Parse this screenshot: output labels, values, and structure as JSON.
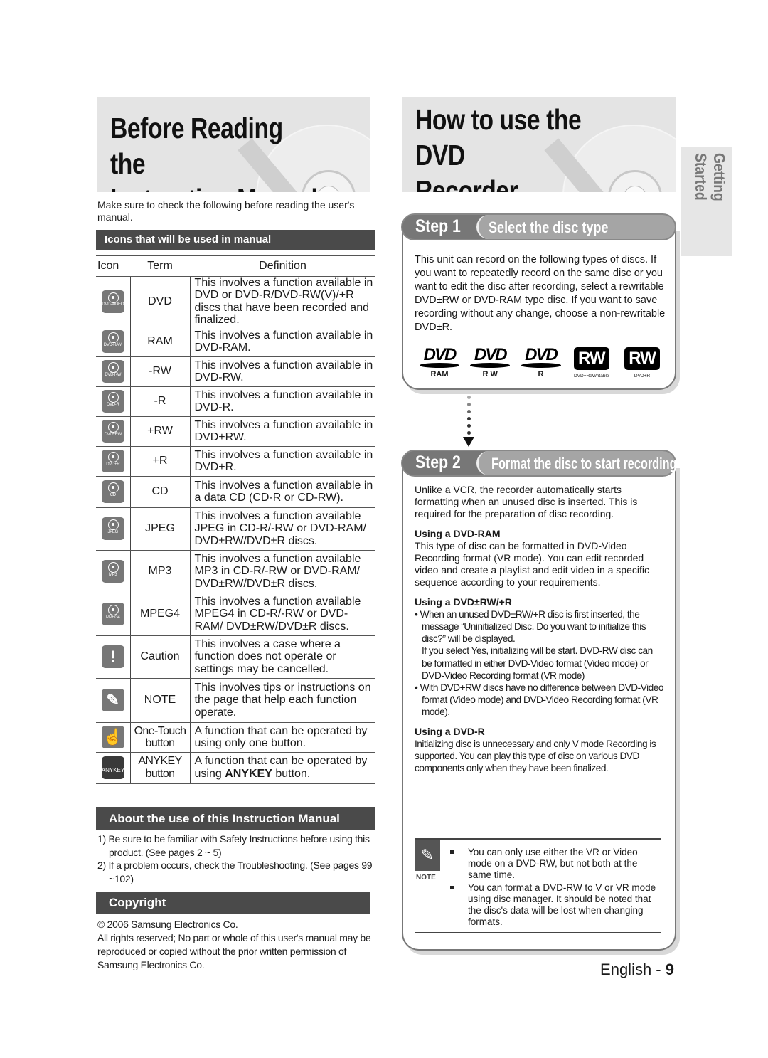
{
  "left": {
    "title": [
      "Before Reading the",
      "Instruction Manual"
    ],
    "intro": "Make sure to check the following before reading the user's manual.",
    "icons_section_title": "Icons that will be used in manual",
    "table": {
      "headers": [
        "Icon",
        "Term",
        "Definition"
      ],
      "rows": [
        {
          "icon": "dvd-video-disc-icon",
          "icon_label": "DVD-VIDEO",
          "term": "DVD",
          "definition": "This involves a function available in DVD or DVD-R/DVD-RW(V)/+R discs that have been recorded and finalized."
        },
        {
          "icon": "dvd-ram-disc-icon",
          "icon_label": "DVD-RAM",
          "term": "RAM",
          "definition": "This involves a function available in DVD-RAM."
        },
        {
          "icon": "dvd-rw-disc-icon",
          "icon_label": "DVD-RW",
          "term": "-RW",
          "definition": "This involves a function available in DVD-RW."
        },
        {
          "icon": "dvd-r-disc-icon",
          "icon_label": "DVD-R",
          "term": "-R",
          "definition": "This involves a function available in DVD-R."
        },
        {
          "icon": "dvd-plus-rw-disc-icon",
          "icon_label": "DVD+RW",
          "term": "+RW",
          "definition": "This involves a function available in DVD+RW."
        },
        {
          "icon": "dvd-plus-r-disc-icon",
          "icon_label": "DVD+R",
          "term": "+R",
          "definition": "This involves a function available in DVD+R."
        },
        {
          "icon": "cd-disc-icon",
          "icon_label": "CD",
          "term": "CD",
          "definition": "This involves a function available in a data CD (CD-R or CD-RW)."
        },
        {
          "icon": "jpeg-disc-icon",
          "icon_label": "JPEG",
          "term": "JPEG",
          "definition": "This involves a function available JPEG in CD-R/-RW or DVD-RAM/ DVD±RW/DVD±R discs."
        },
        {
          "icon": "mp3-disc-icon",
          "icon_label": "MP3",
          "term": "MP3",
          "definition": "This involves a function available MP3 in CD-R/-RW or DVD-RAM/ DVD±RW/DVD±R discs."
        },
        {
          "icon": "mpeg4-disc-icon",
          "icon_label": "MPEG4",
          "term": "MPEG4",
          "definition": "This involves a function available MPEG4 in CD-R/-RW or DVD-RAM/ DVD±RW/DVD±R discs."
        },
        {
          "icon": "caution-icon",
          "icon_label": "!",
          "term": "Caution",
          "definition": "This involves a case where a function does not operate or settings may be cancelled."
        },
        {
          "icon": "note-pencil-icon",
          "icon_label": "✎",
          "term": "NOTE",
          "definition": "This involves tips or instructions on the page that help each function operate."
        },
        {
          "icon": "one-touch-hand-icon",
          "icon_label": "☝",
          "term": "One-Touch button",
          "definition": "A function that can be operated by using only one button."
        },
        {
          "icon": "anykey-icon",
          "icon_label": "ANYKEY",
          "term": "ANYKEY button",
          "definition_pre": "A function that can be operated by using ",
          "definition_bold": "ANYKEY",
          "definition_post": " button."
        }
      ]
    },
    "about_title": "About the use of this Instruction Manual",
    "about_items": [
      "1) Be sure to be familiar with Safety Instructions before using this product. (See pages 2 ~ 5)",
      "2) If a problem occurs, check the Troubleshooting. (See pages 99 ~102)"
    ],
    "copyright_title": "Copyright",
    "copyright_lines": [
      "© 2006 Samsung Electronics Co.",
      "All rights reserved; No part or whole of this user's manual may be reproduced or copied without the prior written permission of Samsung Electronics Co."
    ]
  },
  "right": {
    "title": [
      "How to use the DVD",
      "Recorder"
    ],
    "side_tab": "Getting Started",
    "step1": {
      "number": "Step 1",
      "title": "Select the disc type",
      "text": "This unit can record on the following types of discs. If you want to repeatedly record on the same disc or you want to edit the disc after recording, select a rewritable DVD±RW or DVD-RAM type disc. If you want to save recording without any change, choose a non-rewritable DVD±R.",
      "logos": [
        {
          "mark": "DVD",
          "caption": "RAM"
        },
        {
          "mark": "DVD",
          "caption": "R W"
        },
        {
          "mark": "DVD",
          "caption": "R"
        },
        {
          "mark": "RW",
          "caption": "DVD+ReWritable"
        },
        {
          "mark": "RW",
          "caption": "DVD+R"
        }
      ]
    },
    "step2": {
      "number": "Step 2",
      "title": "Format the disc to start recording",
      "intro": "Unlike a VCR, the recorder automatically starts formatting when an unused disc is inserted. This is required for the preparation of disc recording.",
      "ram_title": "Using a DVD-RAM",
      "ram_text": "This type of disc can be formatted in DVD-Video Recording format (VR mode). You can edit recorded video and create a playlist and edit video in a specific sequence according to your requirements.",
      "rw_title": "Using a DVD±RW/+R",
      "rw_bullet1": "• When an unused DVD±RW/+R disc is first inserted, the message “Uninitialized Disc. Do you want to initialize this disc?” will be displayed.",
      "rw_bullet1b": "If you select Yes, initializing will be start. DVD-RW disc can be formatted in either DVD-Video format (Video mode) or DVD-Video Recording format (VR mode)",
      "rw_bullet2": "• With DVD+RW discs have no difference between DVD-Video format (Video mode) and DVD-Video Recording format (VR mode).",
      "r_title": "Using a DVD-R",
      "r_text": "Initializing disc is unnecessary and only V mode Recording is supported. You can play this type of disc on various DVD components only when they have been finalized."
    },
    "note": {
      "label": "NOTE",
      "items": [
        "You can only use either the VR or Video mode on a DVD-RW, but not both at the same time.",
        "You can format a DVD-RW to V or VR mode using disc manager. It should be noted that the disc's data will be lost when changing formats."
      ]
    },
    "page": {
      "language": "English - ",
      "number": "9"
    }
  }
}
